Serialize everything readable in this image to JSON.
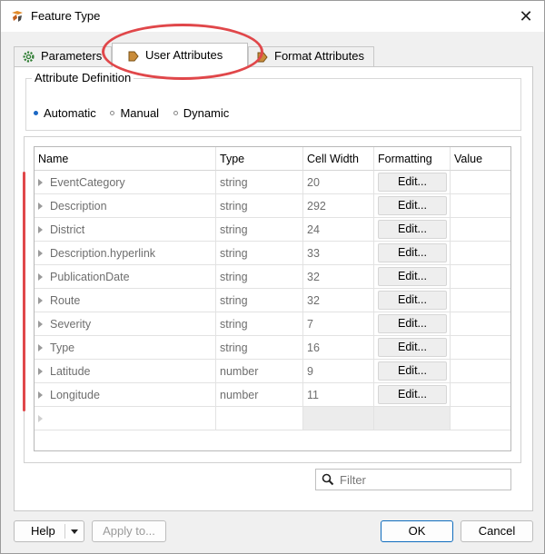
{
  "window": {
    "title": "Feature Type",
    "close_glyph": "✕"
  },
  "tabs": [
    {
      "label": "Parameters",
      "icon": "gear-icon",
      "active": false
    },
    {
      "label": "User Attributes",
      "icon": "transformer-arrow-icon",
      "active": true
    },
    {
      "label": "Format Attributes",
      "icon": "transformer-arrow-icon",
      "active": false
    }
  ],
  "attribute_definition": {
    "legend": "Attribute Definition",
    "options": [
      {
        "label": "Automatic",
        "selected": true
      },
      {
        "label": "Manual",
        "selected": false
      },
      {
        "label": "Dynamic",
        "selected": false
      }
    ]
  },
  "grid": {
    "headers": {
      "name": "Name",
      "type": "Type",
      "width": "Cell Width",
      "formatting": "Formatting",
      "value": "Value"
    },
    "edit_label": "Edit...",
    "rows": [
      {
        "name": "EventCategory",
        "type": "string",
        "width": "20",
        "value": ""
      },
      {
        "name": "Description",
        "type": "string",
        "width": "292",
        "value": ""
      },
      {
        "name": "District",
        "type": "string",
        "width": "24",
        "value": ""
      },
      {
        "name": "Description.hyperlink",
        "type": "string",
        "width": "33",
        "value": ""
      },
      {
        "name": "PublicationDate",
        "type": "string",
        "width": "32",
        "value": ""
      },
      {
        "name": "Route",
        "type": "string",
        "width": "32",
        "value": ""
      },
      {
        "name": "Severity",
        "type": "string",
        "width": "7",
        "value": ""
      },
      {
        "name": "Type",
        "type": "string",
        "width": "16",
        "value": ""
      },
      {
        "name": "Latitude",
        "type": "number",
        "width": "9",
        "value": ""
      },
      {
        "name": "Longitude",
        "type": "number",
        "width": "11",
        "value": ""
      }
    ]
  },
  "filter": {
    "placeholder": "Filter"
  },
  "footer": {
    "help": "Help",
    "apply": "Apply to...",
    "ok": "OK",
    "cancel": "Cancel"
  },
  "colors": {
    "annotation": "#e0474a",
    "accent": "#0f6cbd",
    "radio_selected": "#1d68c4"
  }
}
